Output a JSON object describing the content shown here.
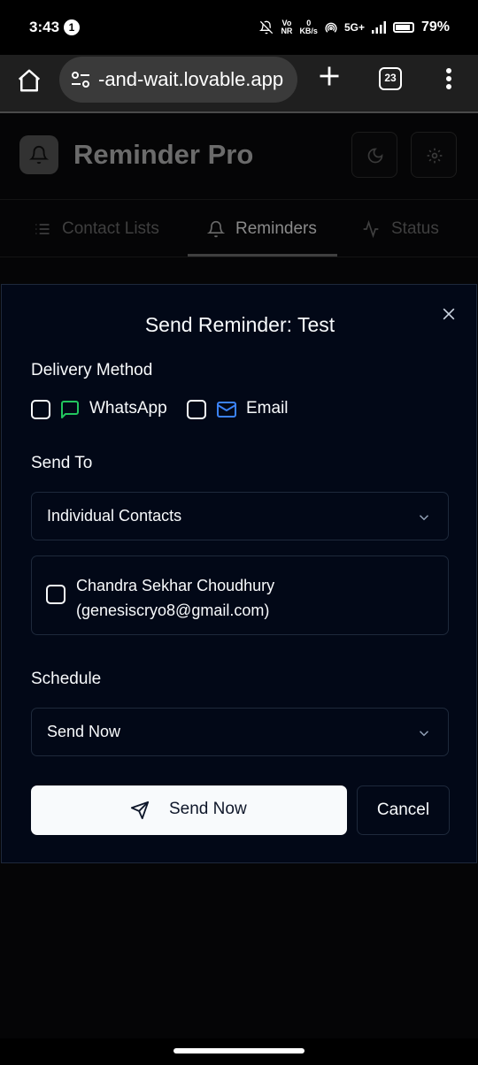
{
  "status_bar": {
    "time": "3:43",
    "notification_count": "1",
    "volte_top": "Vo",
    "volte_bottom": "NR",
    "speed_value": "0",
    "speed_unit": "KB/s",
    "network": "5G+",
    "battery": "79%"
  },
  "browser": {
    "url": "-and-wait.lovable.app",
    "tab_count": "23"
  },
  "app": {
    "title": "Reminder Pro",
    "tabs": [
      {
        "label": "Contact Lists",
        "icon": "list-icon",
        "active": false
      },
      {
        "label": "Reminders",
        "icon": "bell-icon",
        "active": true
      },
      {
        "label": "Status",
        "icon": "activity-icon",
        "active": false
      }
    ]
  },
  "modal": {
    "title": "Send Reminder: Test",
    "delivery_label": "Delivery Method",
    "options": [
      {
        "label": "WhatsApp",
        "icon": "message-icon",
        "checked": false,
        "color": "#22c55e"
      },
      {
        "label": "Email",
        "icon": "mail-icon",
        "checked": false,
        "color": "#3b82f6"
      }
    ],
    "send_to_label": "Send To",
    "send_to_value": "Individual Contacts",
    "contacts": [
      {
        "name": "Chandra Sekhar Choudhury",
        "email": "(genesiscryo8@gmail.com)",
        "checked": false
      }
    ],
    "schedule_label": "Schedule",
    "schedule_value": "Send Now",
    "primary_button": "Send Now",
    "cancel_button": "Cancel"
  },
  "colors": {
    "modal_bg": "#020817",
    "border": "#1e293b",
    "foreground": "#f8fafc",
    "primary_text": "#0f172a"
  }
}
